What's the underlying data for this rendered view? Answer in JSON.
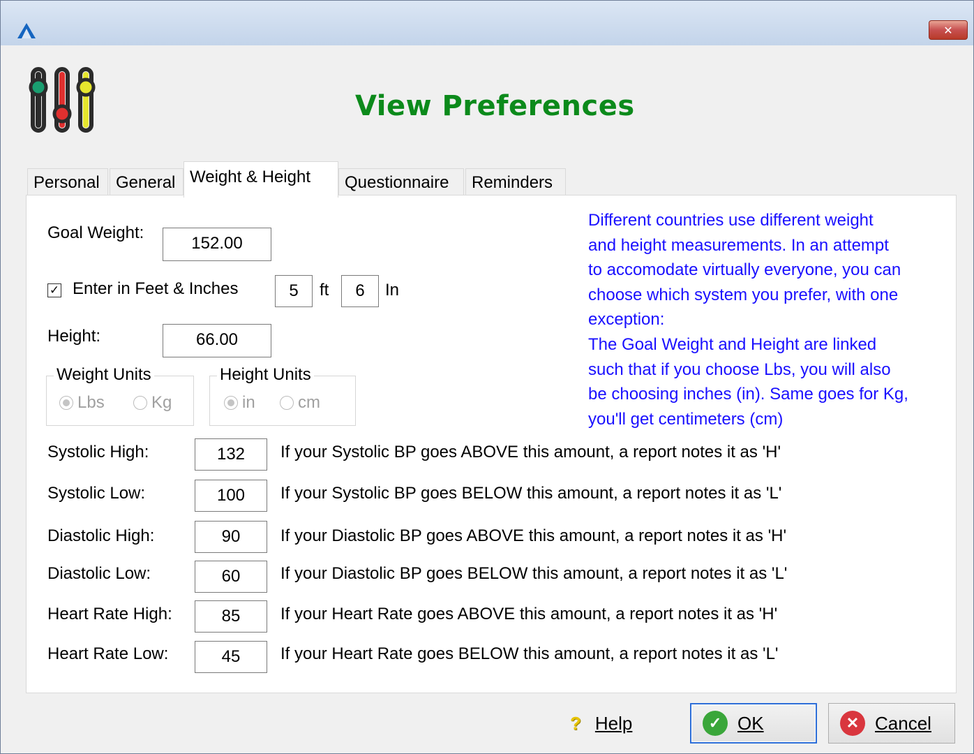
{
  "window": {
    "close_glyph": "✕"
  },
  "header": {
    "title": "View Preferences",
    "icon": "sliders-icon"
  },
  "tabs": [
    {
      "label": "Personal"
    },
    {
      "label": "General"
    },
    {
      "label": "Weight & Height",
      "active": true
    },
    {
      "label": "Questionnaire"
    },
    {
      "label": "Reminders"
    }
  ],
  "form": {
    "goal_weight_label": "Goal Weight:",
    "goal_weight_value": "152.00",
    "feet_inches_label": "Enter in Feet & Inches",
    "feet_inches_checked": true,
    "feet_value": "5",
    "feet_unit": "ft",
    "inches_value": "6",
    "inches_unit": "In",
    "height_label": "Height:",
    "height_value": "66.00"
  },
  "weight_units": {
    "title": "Weight Units",
    "options": [
      "Lbs",
      "Kg"
    ],
    "selected": "Lbs"
  },
  "height_units": {
    "title": "Height Units",
    "options": [
      "in",
      "cm"
    ],
    "selected": "in"
  },
  "info_text": [
    "Different countries use different weight",
    "and height measurements. In an attempt",
    "to accomodate virtually everyone, you can",
    "choose which system you prefer, with one",
    "exception:",
    "The Goal Weight and Height are linked",
    "such that if you choose Lbs, you will also",
    "be choosing inches (in). Same goes for Kg,",
    "you'll get centimeters (cm)"
  ],
  "thresholds": [
    {
      "label": "Systolic High:",
      "value": "132",
      "note": "If your Systolic BP goes ABOVE this amount, a report notes it as 'H'"
    },
    {
      "label": "Systolic Low:",
      "value": "100",
      "note": "If your Systolic BP goes BELOW this amount, a report notes it as 'L'"
    },
    {
      "label": "Diastolic High:",
      "value": "90",
      "note": "If your Diastolic BP goes ABOVE this amount, a report notes it as 'H'"
    },
    {
      "label": "Diastolic Low:",
      "value": "60",
      "note": "If your Diastolic BP goes BELOW this amount, a report notes it as 'L'"
    },
    {
      "label": "Heart Rate High:",
      "value": "85",
      "note": "If your Heart Rate goes ABOVE  this amount, a report notes it as 'H'"
    },
    {
      "label": "Heart Rate Low:",
      "value": "45",
      "note": "If your Heart Rate goes BELOW this amount, a report notes it as 'L'"
    }
  ],
  "buttons": {
    "help_label": "Help",
    "ok_label": "OK",
    "cancel_label": "Cancel"
  },
  "colors": {
    "title_green": "#0c8a1b",
    "info_blue": "#1a10ff",
    "ok_green": "#3aa63a",
    "cancel_red": "#d9363e"
  }
}
